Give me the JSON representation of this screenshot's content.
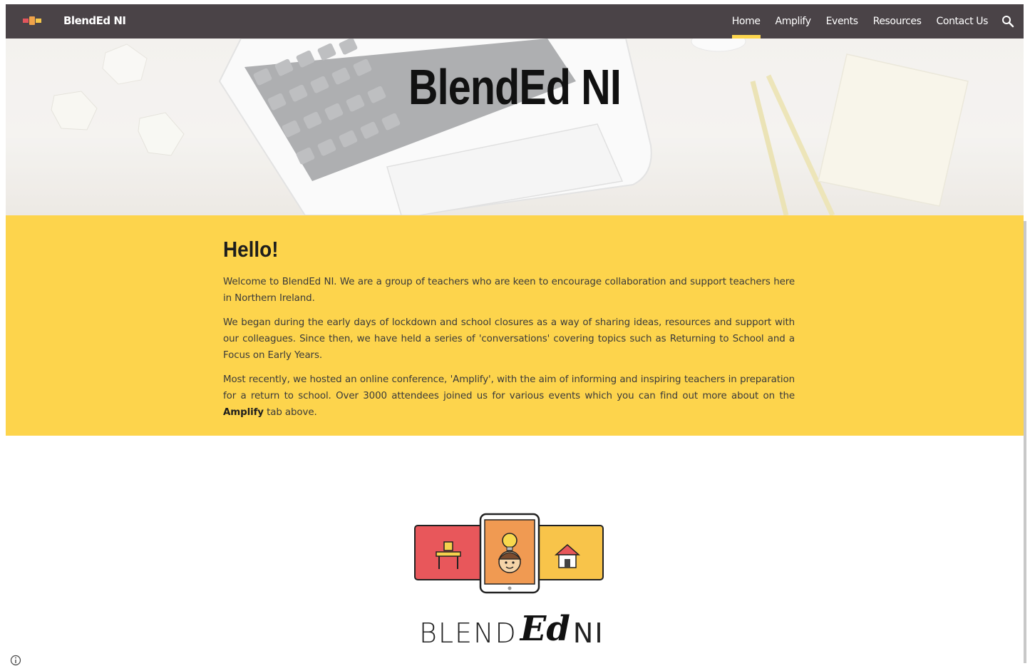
{
  "header": {
    "site_title": "BlendEd NI",
    "nav": [
      {
        "label": "Home",
        "active": true
      },
      {
        "label": "Amplify",
        "active": false
      },
      {
        "label": "Events",
        "active": false
      },
      {
        "label": "Resources",
        "active": false
      },
      {
        "label": "Contact Us",
        "active": false
      }
    ],
    "search_icon": "search-icon"
  },
  "hero": {
    "title": "BlendEd NI"
  },
  "intro": {
    "heading": "Hello!",
    "paragraph1": "Welcome to BlendEd NI. We are a group of teachers who are keen to encourage collaboration and support teachers here in Northern Ireland.",
    "paragraph2": "We began during the early days of lockdown and school closures as a way of sharing ideas, resources and support with our colleagues. Since then, we have held a series of 'conversations' covering topics such as Returning to School and a Focus on Early Years.",
    "paragraph3_before": "Most recently, we hosted an online conference, 'Amplify', with the aim of informing and inspiring teachers in preparation for a return to school. Over 3000 attendees joined us for various events which you can find out more about on the ",
    "paragraph3_bold": "Amplify",
    "paragraph3_after": " tab above."
  },
  "logo": {
    "word_blend": "BLEND",
    "word_ed": "Ed",
    "word_ni": "NI"
  },
  "colors": {
    "topbar": "#4a4347",
    "accent": "#fdd44c",
    "active_underline": "#fdd64d"
  }
}
